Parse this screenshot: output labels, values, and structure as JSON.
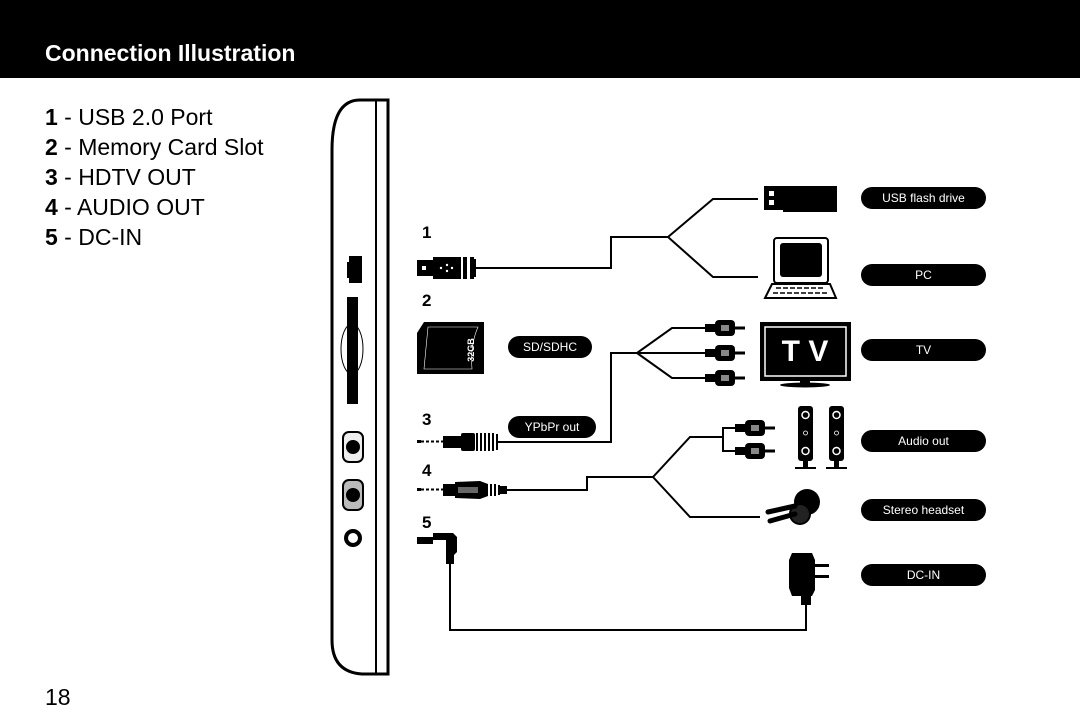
{
  "header": {
    "title": "Connection Illustration"
  },
  "legend": [
    {
      "num": "1",
      "label": " - USB 2.0 Port"
    },
    {
      "num": "2",
      "label": " - Memory Card Slot"
    },
    {
      "num": "3",
      "label": " - HDTV OUT"
    },
    {
      "num": "4",
      "label": " - AUDIO OUT"
    },
    {
      "num": "5",
      "label": " - DC-IN"
    }
  ],
  "port_numbers": [
    "1",
    "2",
    "3",
    "4",
    "5"
  ],
  "labels": {
    "sd_sdhc": "SD/SDHC",
    "ypbpr_out": "YPbPr out",
    "usb_flash_drive": "USB flash drive",
    "pc": "PC",
    "tv": "TV",
    "audio_out": "Audio out",
    "stereo_headset": "Stereo headset",
    "dc_in": "DC-IN"
  },
  "icons": {
    "sd_card_capacity": "32GB",
    "tv_screen_text": "T V"
  },
  "page_number": "18"
}
